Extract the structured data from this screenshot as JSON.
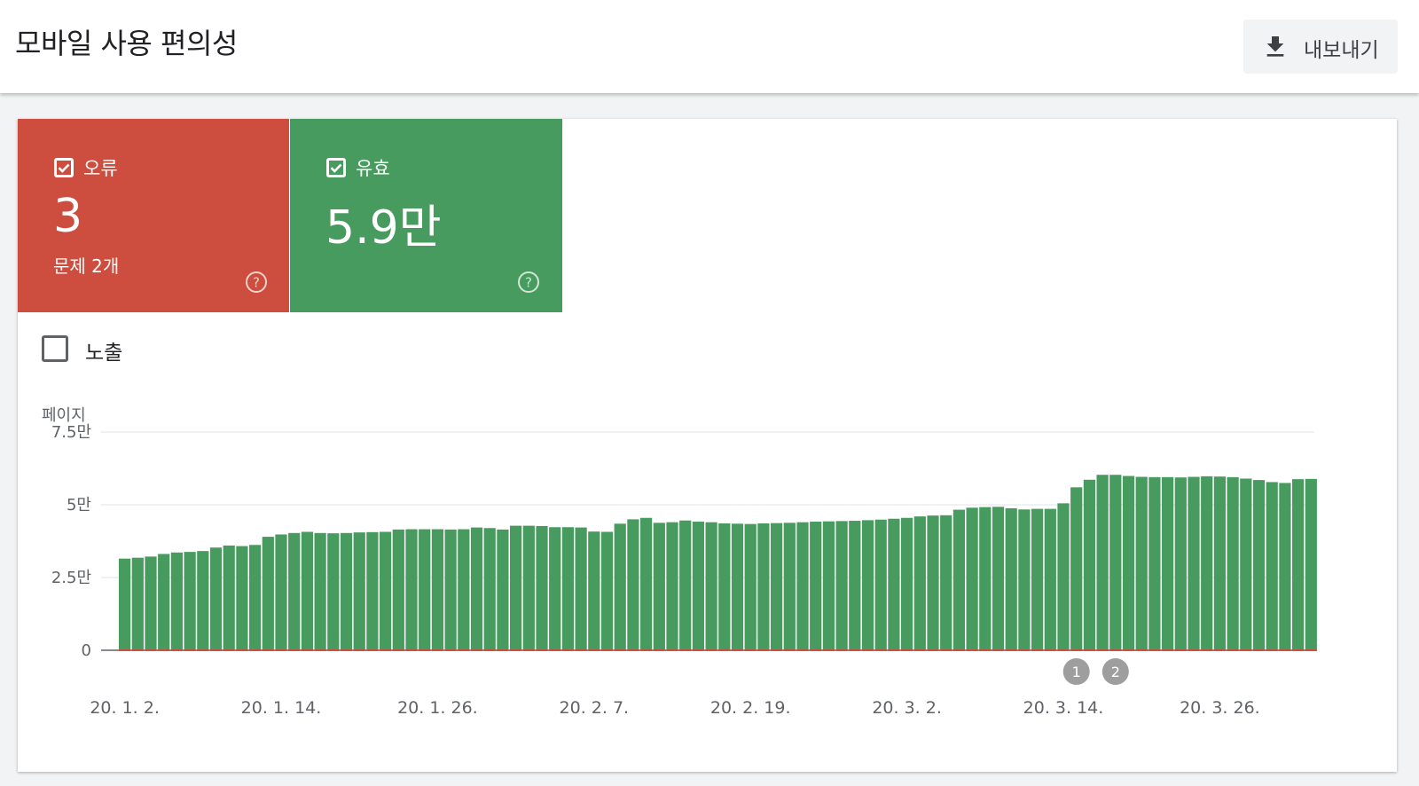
{
  "header": {
    "title": "모바일 사용 편의성",
    "export_label": "내보내기",
    "export_icon": "download-icon"
  },
  "tiles": [
    {
      "key": "error",
      "label": "오류",
      "value": "3",
      "sub": "문제 2개",
      "checked": true,
      "color": "#cd4e3f"
    },
    {
      "key": "valid",
      "label": "유효",
      "value": "5.9만",
      "sub": "",
      "checked": true,
      "color": "#479b5e"
    }
  ],
  "impressions": {
    "label": "노출",
    "checked": false
  },
  "chart_data": {
    "type": "bar",
    "ylabel": "페이지",
    "ylim": [
      0,
      75000
    ],
    "y_ticks": [
      {
        "value": 0,
        "label": "0"
      },
      {
        "value": 25000,
        "label": "2.5만"
      },
      {
        "value": 50000,
        "label": "5만"
      },
      {
        "value": 75000,
        "label": "7.5만"
      }
    ],
    "x_tick_labels": [
      {
        "index": 0,
        "label": "20. 1. 2."
      },
      {
        "index": 12,
        "label": "20. 1. 14."
      },
      {
        "index": 24,
        "label": "20. 1. 26."
      },
      {
        "index": 36,
        "label": "20. 2. 7."
      },
      {
        "index": 48,
        "label": "20. 2. 19."
      },
      {
        "index": 60,
        "label": "20. 3. 2."
      },
      {
        "index": 72,
        "label": "20. 3. 14."
      },
      {
        "index": 84,
        "label": "20. 3. 26."
      }
    ],
    "series": [
      {
        "name": "유효",
        "color": "#479b5e",
        "values": [
          31500,
          31800,
          32200,
          33100,
          33600,
          33800,
          34100,
          35300,
          36000,
          35800,
          36200,
          39000,
          39800,
          40300,
          40700,
          40300,
          40200,
          40300,
          40500,
          40600,
          40700,
          41500,
          41600,
          41600,
          41600,
          41500,
          41600,
          42200,
          42000,
          41500,
          42800,
          42800,
          42700,
          42300,
          42300,
          42200,
          40800,
          40700,
          43500,
          45000,
          45500,
          43800,
          44000,
          44600,
          44200,
          44000,
          43600,
          43500,
          43400,
          43600,
          43700,
          43800,
          44000,
          44200,
          44300,
          44400,
          44500,
          44700,
          44900,
          45200,
          45500,
          46000,
          46300,
          46400,
          48300,
          49000,
          49200,
          49300,
          48800,
          48400,
          48600,
          48600,
          50500,
          56000,
          58600,
          60300,
          60300,
          59900,
          59600,
          59500,
          59500,
          59400,
          59600,
          59800,
          59700,
          59500,
          59000,
          58500,
          57800,
          57500,
          58800,
          58900
        ]
      },
      {
        "name": "오류",
        "color": "#cd4e3f",
        "values": [
          3,
          3,
          3,
          3,
          3,
          3,
          3,
          3,
          3,
          3,
          3,
          3,
          3,
          3,
          3,
          3,
          3,
          3,
          3,
          3,
          3,
          3,
          3,
          3,
          3,
          3,
          3,
          3,
          3,
          3,
          3,
          3,
          3,
          3,
          3,
          3,
          3,
          3,
          3,
          3,
          3,
          3,
          3,
          3,
          3,
          3,
          3,
          3,
          3,
          3,
          3,
          3,
          3,
          3,
          3,
          3,
          3,
          3,
          3,
          3,
          3,
          3,
          3,
          3,
          3,
          3,
          3,
          3,
          3,
          3,
          3,
          3,
          3,
          3,
          3,
          3,
          3,
          3,
          3,
          3,
          3,
          3,
          3,
          3,
          3,
          3,
          3,
          3,
          3,
          3,
          3,
          3
        ]
      }
    ],
    "annotations": [
      {
        "label": "1",
        "index": 73
      },
      {
        "label": "2",
        "index": 76
      }
    ],
    "grid": true
  }
}
